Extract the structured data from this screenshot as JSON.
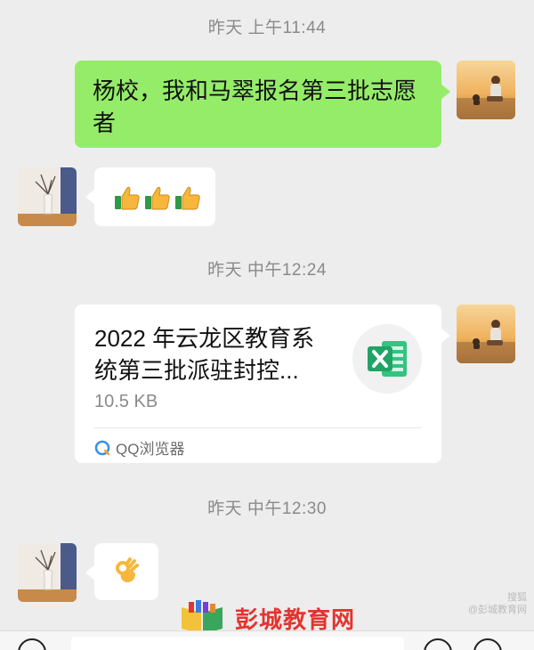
{
  "messages": {
    "ts1": "昨天 上午11:44",
    "msg1_text": "杨校，我和马翠报名第三批志愿者",
    "ts2": "昨天 中午12:24",
    "file_title": "2022 年云龙区教育系统第三批派驻封控...",
    "file_size": "10.5 KB",
    "file_source": "QQ浏览器",
    "ts3": "昨天 中午12:30"
  },
  "watermark": {
    "text": "彭城教育网",
    "badge_line1": "搜狐",
    "badge_line2": "@彭城教育网"
  },
  "colors": {
    "bg": "#ededed",
    "self_bubble": "#95ec69",
    "other_bubble": "#ffffff",
    "timestamp": "#8a8a8a",
    "excel_green": "#21a366",
    "watermark_red": "#e3342f"
  },
  "icons": {
    "thumbs": "thumbs-up-icon",
    "ok": "ok-hand-icon",
    "excel": "excel-file-icon",
    "browser": "qq-browser-icon"
  }
}
